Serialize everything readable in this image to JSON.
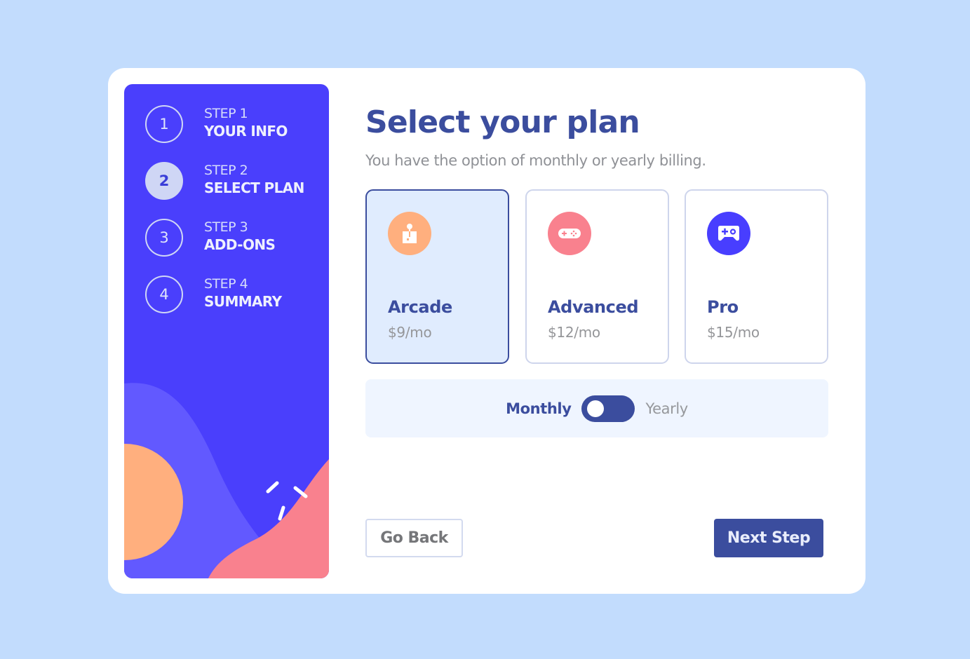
{
  "colors": {
    "page_background": "#c2dcfd",
    "sidebar_background": "#4a3ffc",
    "primary": "#3b4d9e",
    "arcade_icon": "#ffaf7e",
    "advanced_icon": "#f9818e",
    "pro_icon": "#483eff"
  },
  "sidebar": {
    "steps": [
      {
        "number": "1",
        "label": "STEP 1",
        "title": "YOUR INFO",
        "active": false
      },
      {
        "number": "2",
        "label": "STEP 2",
        "title": "SELECT PLAN",
        "active": true
      },
      {
        "number": "3",
        "label": "STEP 3",
        "title": "ADD-ONS",
        "active": false
      },
      {
        "number": "4",
        "label": "STEP 4",
        "title": "SUMMARY",
        "active": false
      }
    ]
  },
  "main": {
    "title": "Select your plan",
    "subtitle": "You have the option of monthly or yearly billing.",
    "plans": [
      {
        "name": "Arcade",
        "price": "$9/mo",
        "icon": "joystick-icon",
        "selected": true
      },
      {
        "name": "Advanced",
        "price": "$12/mo",
        "icon": "gamepad-icon",
        "selected": false
      },
      {
        "name": "Pro",
        "price": "$15/mo",
        "icon": "controller-icon",
        "selected": false
      }
    ],
    "billing": {
      "monthly_label": "Monthly",
      "yearly_label": "Yearly",
      "selected": "Monthly"
    },
    "buttons": {
      "back_label": "Go Back",
      "next_label": "Next Step"
    }
  }
}
